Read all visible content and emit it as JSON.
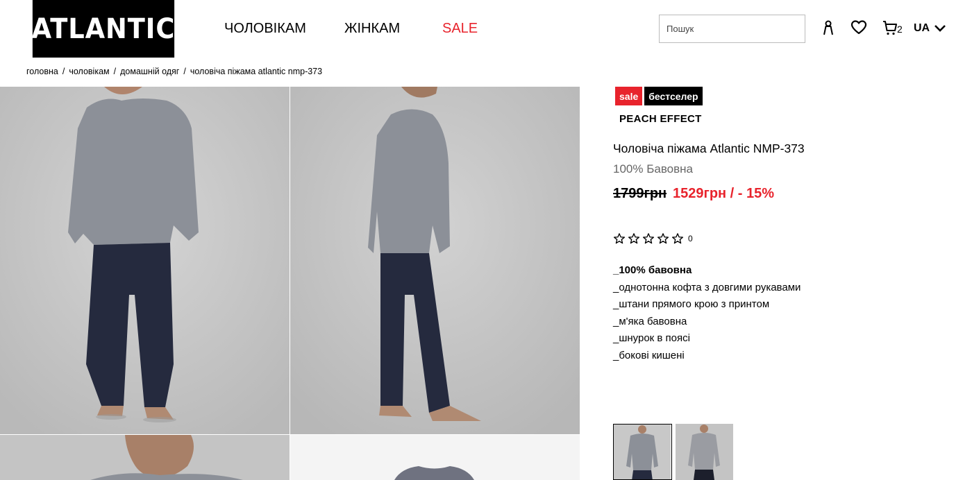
{
  "brand": {
    "logo": "ATLANTIC"
  },
  "nav": {
    "men": "ЧОЛОВІКАМ",
    "women": "ЖІНКАМ",
    "sale": "SALE"
  },
  "header": {
    "search_placeholder": "Пошук",
    "cart_count": "2",
    "language": "UA"
  },
  "breadcrumb": [
    "головна",
    "чоловікам",
    "домашній одяг",
    "чоловіча піжама atlantic nmp-373"
  ],
  "product": {
    "badges": {
      "sale": "sale",
      "bestseller": "бестселер"
    },
    "collection": "PEACH EFFECT",
    "title": "Чоловіча піжама Atlantic NMP-373",
    "material": "100% Бавовна",
    "old_price": "1799грн",
    "new_price": "1529грн / - 15%",
    "rating_count": "0",
    "features": [
      "_100% бавовна",
      "_однотонна кофта з довгими рукавами",
      "_штани прямого крою з принтом",
      "_м'яка бавовна",
      "_шнурок в поясі",
      "_бокові кишені"
    ]
  },
  "colors": {
    "accent": "#e8232c",
    "photo_bg": "#c9c9c9",
    "top": "#8a8d94",
    "pants": "#252a3e"
  },
  "icons": [
    "user-icon",
    "heart-icon",
    "cart-icon",
    "chevron-down-icon",
    "star-icon"
  ]
}
